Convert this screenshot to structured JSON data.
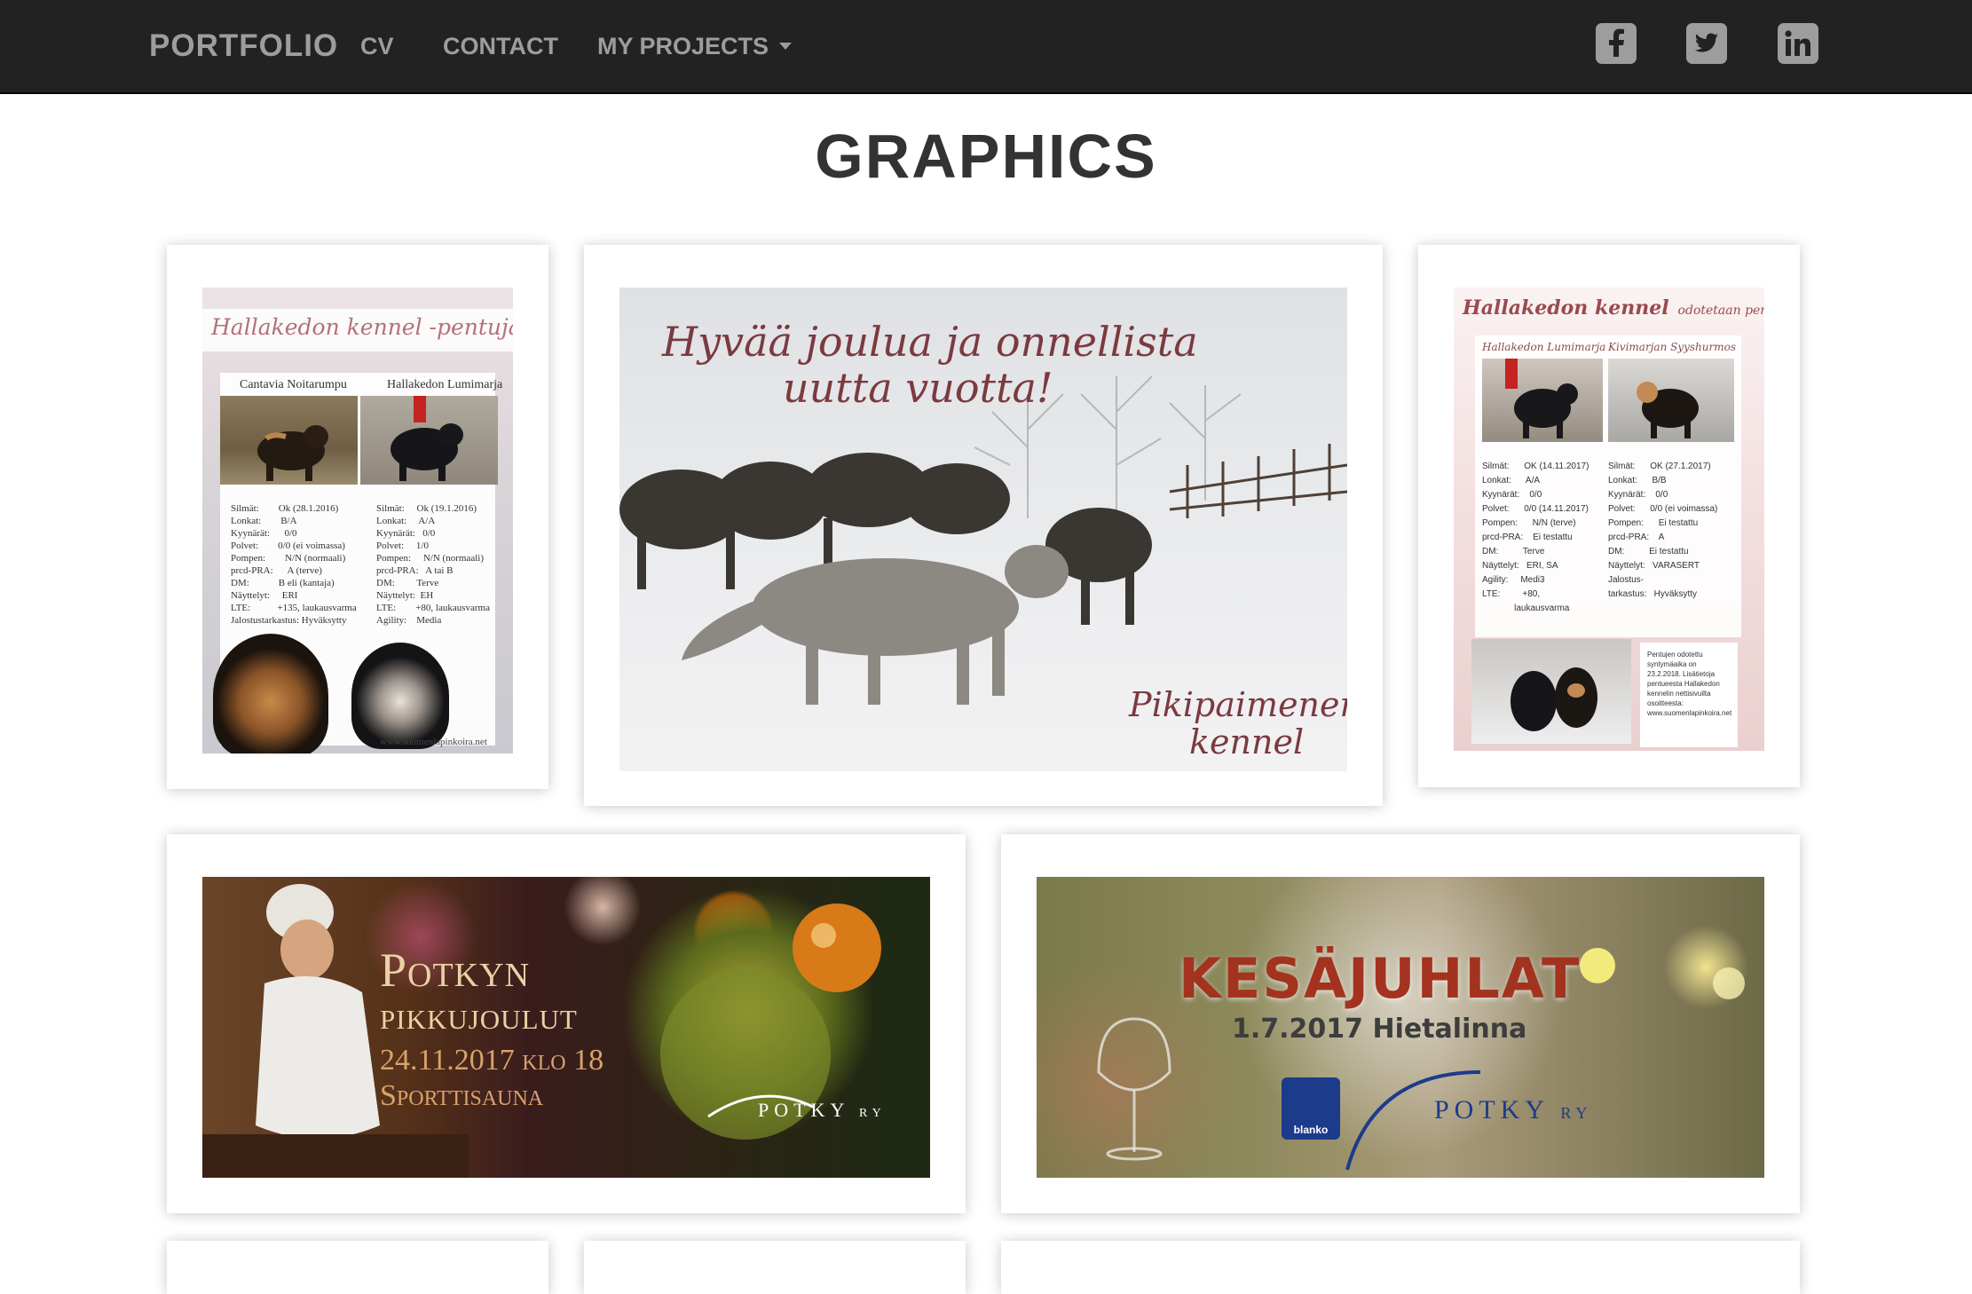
{
  "navbar": {
    "brand": "PORTFOLIO",
    "links": [
      {
        "label": "CV"
      },
      {
        "label": "CONTACT"
      },
      {
        "label": "MY PROJECTS"
      }
    ],
    "social_icons": [
      "facebook-icon",
      "twitter-icon",
      "linkedin-icon"
    ]
  },
  "page_title": "GRAPHICS",
  "colors": {
    "navbar_bg": "#222222",
    "nav_text": "#9d9d9d",
    "title_text": "#333333",
    "page_bg": "#ffffff"
  },
  "gallery": {
    "poster_kennel": {
      "heading": "Hallakedon kennel -pentuja suunnitteilla",
      "dog_left": "Cantavia Noitarumpu",
      "dog_right": "Hallakedon Lumimarja",
      "info_left": "Silmät:        Ok (28.1.2016)\nLonkat:        B/A\nKyynärät:      0/0\nPolvet:        0/0 (ei voimassa)\nPompen:        N/N (normaali)\nprcd-PRA:      A (terve)\nDM:            B eli (kantaja)\nNäyttelyt:     ERI\nLTE:           +135, laukausvarma\nJalostustarkastus: Hyväksytty",
      "info_right": "Silmät:     Ok (19.1.2016)\nLonkat:     A/A\nKyynärät:   0/0\nPolvet:     1/0\nPompen:     N/N (normaali)\nprcd-PRA:   A tai B\nDM:         Terve\nNäyttelyt:  EH\nLTE:        +80, laukausvarma\nAgility:    Media",
      "footer": "www.suomenlapinkoira.net"
    },
    "christmas_card": {
      "greeting_line1": "Hyvää joulua ja onnellista",
      "greeting_line2": "uutta vuotta!",
      "signature_line1": "Pikipaimenen",
      "signature_line2": "kennel"
    },
    "poster_litter": {
      "heading": "Hallakedon kennel",
      "subheading": "odotetaan pentuja",
      "dog_left": "Hallakedon Lumimarja",
      "dog_right": "Kivimarjan Syyshurmos",
      "info_left": "Silmät:      OK (14.11.2017)\nLonkat:      A/A\nKyynärät:    0/0\nPolvet:      0/0 (14.11.2017)\nPompen:      N/N (terve)\nprcd-PRA:    Ei testattu\nDM:          Terve\nNäyttelyt:   ERI, SA\nAgility:     Medi3\nLTE:         +80,\n             laukausvarma",
      "info_right": "Silmät:      OK (27.1.2017)\nLonkat:      B/B\nKyynärät:    0/0\nPolvet:      0/0 (ei voimassa)\nPompen:      Ei testattu\nprcd-PRA:    A\nDM:          Ei testattu\nNäyttelyt:   VARASERT\nJalostus-\ntarkastus:   Hyväksytty",
      "note": "Pentujen odotettu\nsyntymäaika on\n23.2.2018. Lisätietoja\npentueesta Hallakedon\nkennelin nettisivuilta\nosoitteesta:\nwww.suomenlapinkoira.net"
    },
    "banner_pikkujoulut": {
      "title_line1": "Potkyn",
      "title_line2": "pikkujoulut",
      "date": "24.11.2017 klo 18",
      "place": "Sporttisauna",
      "logo_text": "POTKY",
      "logo_suffix": "RY"
    },
    "banner_kesajuhlat": {
      "title": "KESÄJUHLAT",
      "date": "1.7.2017 Hietalinna",
      "partner_logo": "blanko",
      "logo_text": "POTKY",
      "logo_suffix": "RY"
    }
  }
}
